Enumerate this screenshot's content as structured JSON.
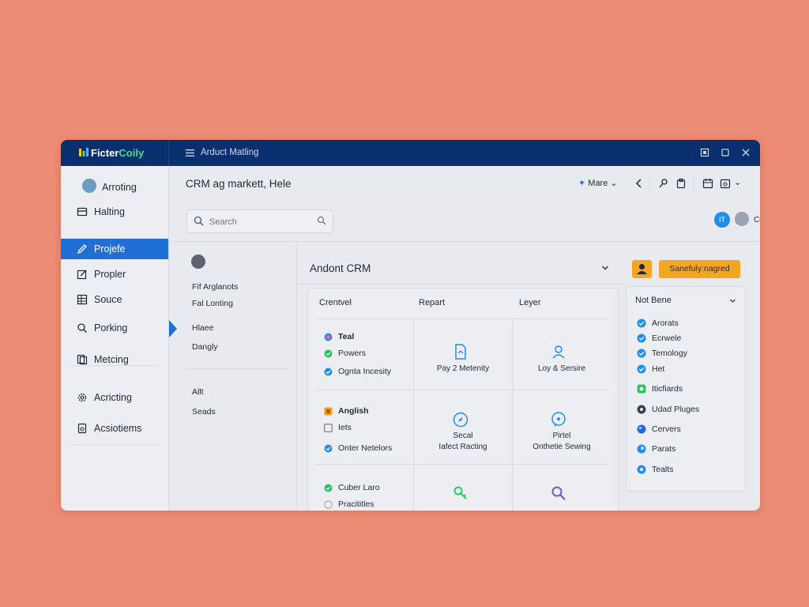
{
  "titlebar": {
    "brand_part1": "Ficter",
    "brand_part2": "Coily",
    "title": "Arduct Matling"
  },
  "sidebar": {
    "items": [
      {
        "label": "Arroting",
        "icon": "user-avatar"
      },
      {
        "label": "Halting",
        "icon": "list-icon"
      },
      {
        "label": "Projefe",
        "icon": "pencil-icon",
        "active": true
      },
      {
        "label": "Propler",
        "icon": "edit-icon"
      },
      {
        "label": "Souce",
        "icon": "grid-icon"
      },
      {
        "label": "Porking",
        "icon": "person-search-icon"
      },
      {
        "label": "Metcing",
        "icon": "copy-icon"
      },
      {
        "label": "Acricting",
        "icon": "gear-icon"
      },
      {
        "label": "Acsiotiems",
        "icon": "document-icon"
      }
    ]
  },
  "header": {
    "page_title": "CRM ag markett, Hele",
    "search_placeholder": "Search",
    "more_label": "Mare",
    "avatar_initials": "IT",
    "user_name": "Coifiet"
  },
  "filters": {
    "items": [
      "Fif Arglanots",
      "Fal Lonting",
      "Hlaee",
      "Dangly",
      "Allt",
      "Seads"
    ]
  },
  "center": {
    "title": "Andont CRM",
    "tabs": [
      "Crentvel",
      "Repart",
      "Leyer"
    ],
    "col1_group1": [
      {
        "label": "Teal",
        "icon": "globe-icon",
        "bold": true
      },
      {
        "label": "Powers",
        "icon": "check-circle-icon"
      },
      {
        "label": "Ognta Incesity",
        "icon": "check-circle-icon"
      }
    ],
    "col1_group2": [
      {
        "label": "Anglish",
        "icon": "flag-icon",
        "bold": true
      },
      {
        "label": "Iets",
        "icon": "checkbox-icon"
      },
      {
        "label": "Onter Netelors",
        "icon": "check-circle-icon"
      }
    ],
    "col1_group3": [
      {
        "label": "Cuber Laro",
        "icon": "check-circle-icon",
        "bold": false
      },
      {
        "label": "Pracititles",
        "icon": "checkbox-icon"
      }
    ],
    "cells": [
      {
        "icon": "document-icon",
        "label": "Pay 2 Metenity"
      },
      {
        "icon": "people-icon",
        "label": "Loy & Sersire"
      },
      {
        "icon": "compass-icon",
        "line1": "Secal",
        "line2": "Iafect Racting"
      },
      {
        "icon": "chat-icon",
        "line1": "Pirtel",
        "line2": "Onthetie Sewing"
      },
      {
        "icon": "key-icon",
        "label": ""
      },
      {
        "icon": "search-icon",
        "label": ""
      }
    ]
  },
  "right": {
    "badge_label": "Sanefuly:nagred",
    "panel_title": "Not Bene",
    "items": [
      {
        "label": "Arorats",
        "icon": "check-blue-icon"
      },
      {
        "label": "Ecrwele",
        "icon": "check-blue-icon"
      },
      {
        "label": "Temology",
        "icon": "check-blue-icon"
      },
      {
        "label": "Het",
        "icon": "check-blue-icon"
      },
      {
        "label": "Iticfiards",
        "icon": "green-square-icon"
      },
      {
        "label": "Udad Pluges",
        "icon": "dark-circle-icon"
      },
      {
        "label": "Cervers",
        "icon": "blue-dot-icon"
      },
      {
        "label": "Parats",
        "icon": "blue-dot-icon"
      },
      {
        "label": "Tealts",
        "icon": "blue-dot-icon"
      }
    ]
  },
  "colors": {
    "background": "#ec8b74",
    "titlebar": "#0a2f6e",
    "accent": "#1f6fd6",
    "badge": "#f5a524",
    "success": "#22c55e"
  }
}
